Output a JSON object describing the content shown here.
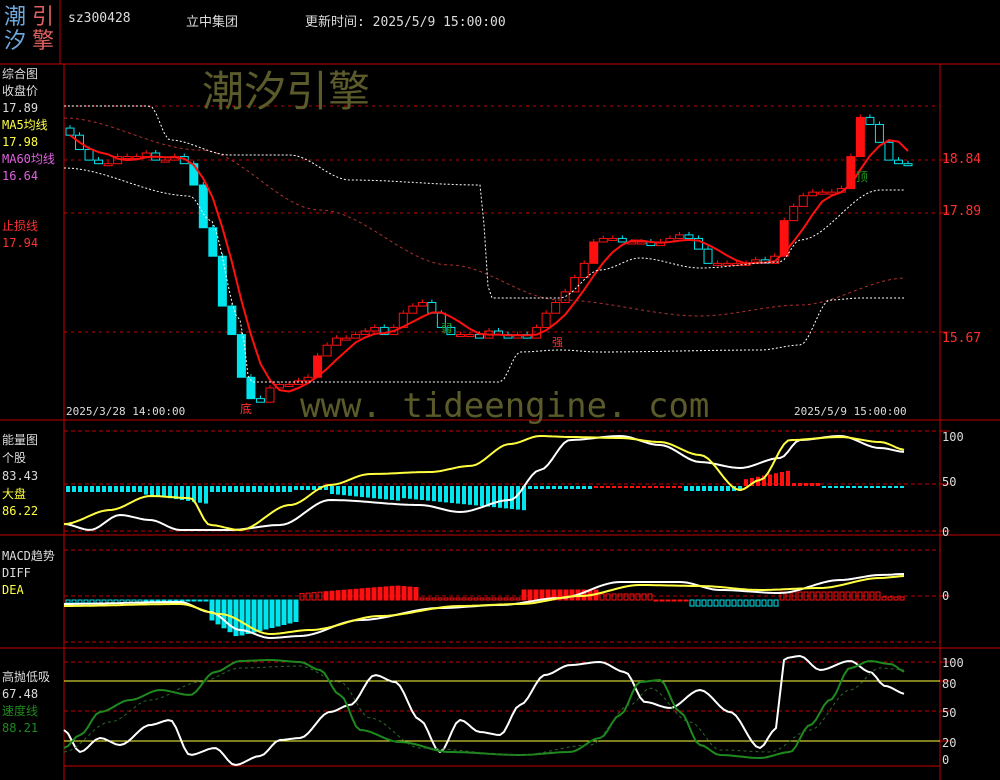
{
  "header": {
    "logo_chars": [
      "潮",
      "引",
      "汐",
      "擎"
    ],
    "code": "sz300428",
    "name": "立中集团",
    "update_label": "更新时间: 2025/5/9 15:00:00"
  },
  "watermark": {
    "title": "潮汐引擎",
    "url": "www. tideengine. com"
  },
  "panel1": {
    "title": "综合图",
    "close_label": "收盘价",
    "close_value": "17.89",
    "ma5_label": "MA5均线",
    "ma5_value": "17.98",
    "ma60_label": "MA60均线",
    "ma60_value": "16.64",
    "stop_label": "止损线",
    "stop_value": "17.94",
    "date_start": "2025/3/28 14:00:00",
    "date_end": "2025/5/9 15:00:00",
    "axis_ticks": [
      "18.84",
      "17.89",
      "15.67"
    ],
    "mark_top": "顶",
    "mark_bottom": "底",
    "mark_weak": "弱",
    "mark_strong": "强"
  },
  "panel2": {
    "title": "能量图",
    "stock_label": "个股",
    "stock_value": "83.43",
    "market_label": "大盘",
    "market_value": "86.22",
    "axis_ticks": [
      "100",
      "50",
      "0"
    ]
  },
  "panel3": {
    "title": "MACD趋势",
    "diff_label": "DIFF",
    "dea_label": "DEA",
    "axis_ticks": [
      "0"
    ]
  },
  "panel4": {
    "title": "高抛低吸",
    "value": "67.48",
    "speed_label": "速度线",
    "speed_value": "88.21",
    "axis_ticks": [
      "100",
      "80",
      "50",
      "20",
      "0"
    ]
  },
  "colors": {
    "grid": "#c00000",
    "bull": "#ff1010",
    "bear": "#00e5ee",
    "ma60": "#b03030",
    "white": "#ffffff",
    "yellow": "#ffff40",
    "green": "#1e8a1e",
    "watermark": "#5a5a2a"
  },
  "chart_data": [
    {
      "type": "candlestick",
      "name": "综合图",
      "x_range": [
        "2025/3/28 14:00:00",
        "2025/5/9 15:00:00"
      ],
      "y_ticks": [
        18.84,
        17.89,
        15.67
      ],
      "close": [
        18.3,
        18.1,
        17.95,
        17.9,
        17.9,
        18.0,
        18.0,
        18.0,
        18.05,
        17.95,
        17.95,
        18.0,
        17.9,
        17.6,
        17.0,
        16.6,
        15.9,
        15.5,
        14.9,
        14.6,
        14.55,
        14.75,
        14.8,
        14.8,
        14.85,
        14.9,
        15.2,
        15.35,
        15.45,
        15.45,
        15.5,
        15.55,
        15.6,
        15.5,
        15.6,
        15.8,
        15.9,
        15.95,
        15.8,
        15.6,
        15.5,
        15.5,
        15.5,
        15.45,
        15.55,
        15.5,
        15.45,
        15.5,
        15.45,
        15.6,
        15.8,
        15.95,
        16.1,
        16.3,
        16.5,
        16.8,
        16.85,
        16.85,
        16.8,
        16.8,
        16.8,
        16.75,
        16.8,
        16.85,
        16.9,
        16.85,
        16.7,
        16.5,
        16.5,
        16.5,
        16.5,
        16.5,
        16.55,
        16.5,
        16.6,
        17.1,
        17.3,
        17.45,
        17.5,
        17.5,
        17.5,
        17.55,
        18.0,
        18.55,
        18.45,
        18.2,
        17.95,
        17.9,
        17.89
      ],
      "ma5_last": 17.98,
      "ma60_last": 16.64,
      "stop_last": 17.94
    },
    {
      "type": "line",
      "name": "能量图",
      "y_ticks": [
        100,
        50,
        0
      ],
      "series": [
        {
          "name": "个股",
          "last": 83.43
        },
        {
          "name": "大盘",
          "last": 86.22
        }
      ]
    },
    {
      "type": "line",
      "name": "MACD趋势",
      "y_ticks": [
        0
      ],
      "series": [
        {
          "name": "DIFF"
        },
        {
          "name": "DEA"
        }
      ]
    },
    {
      "type": "line",
      "name": "高抛低吸",
      "y_ticks": [
        100,
        80,
        50,
        20,
        0
      ],
      "series": [
        {
          "name": "高抛低吸",
          "last": 67.48
        },
        {
          "name": "速度线",
          "last": 88.21
        }
      ]
    }
  ]
}
